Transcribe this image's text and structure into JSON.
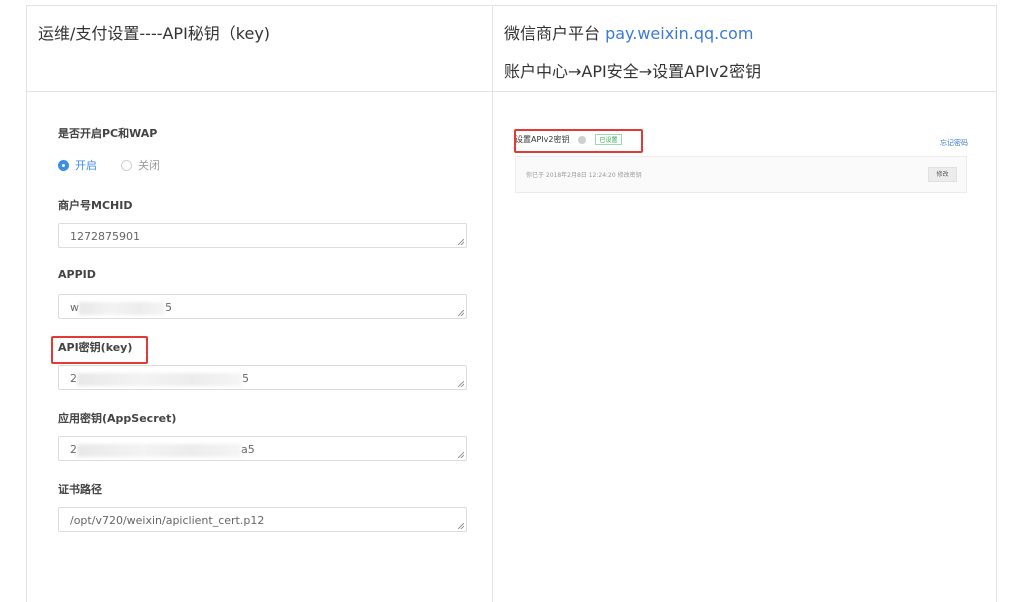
{
  "header": {
    "left_title": "运维/支付设置----API秘钥（key)",
    "right_line1_prefix": "微信商户平台 ",
    "right_line1_link": "pay.weixin.qq.com",
    "right_line2": "账户中心→API安全→设置APIv2密钥"
  },
  "form": {
    "enable_label": "是否开启PC和WAP",
    "options": {
      "on": "开启",
      "off": "关闭"
    },
    "selected": "开启",
    "mchid_label": "商户号MCHID",
    "mchid_value": "1272875901",
    "appid_label": "APPID",
    "appid_prefix": "w",
    "appid_suffix": "5",
    "apikey_label": "API密钥(key)",
    "apikey_prefix": "2",
    "apikey_suffix": "5",
    "appsecret_label": "应用密钥(AppSecret)",
    "appsecret_prefix": "2",
    "appsecret_suffix": "a5",
    "cert_label": "证书路径",
    "cert_value": "/opt/v720/weixin/apiclient_cert.p12"
  },
  "screenshot": {
    "title": "设置APIv2密钥",
    "badge": "已设置",
    "link": "忘记密码",
    "card_text": "你已于 2018年2月8日 12:24:20 修改密钥",
    "button": "修改"
  },
  "colors": {
    "accent": "#3a8ee6",
    "link": "#3a7ad8",
    "highlight": "#e53935",
    "border": "#e3e3e3"
  }
}
